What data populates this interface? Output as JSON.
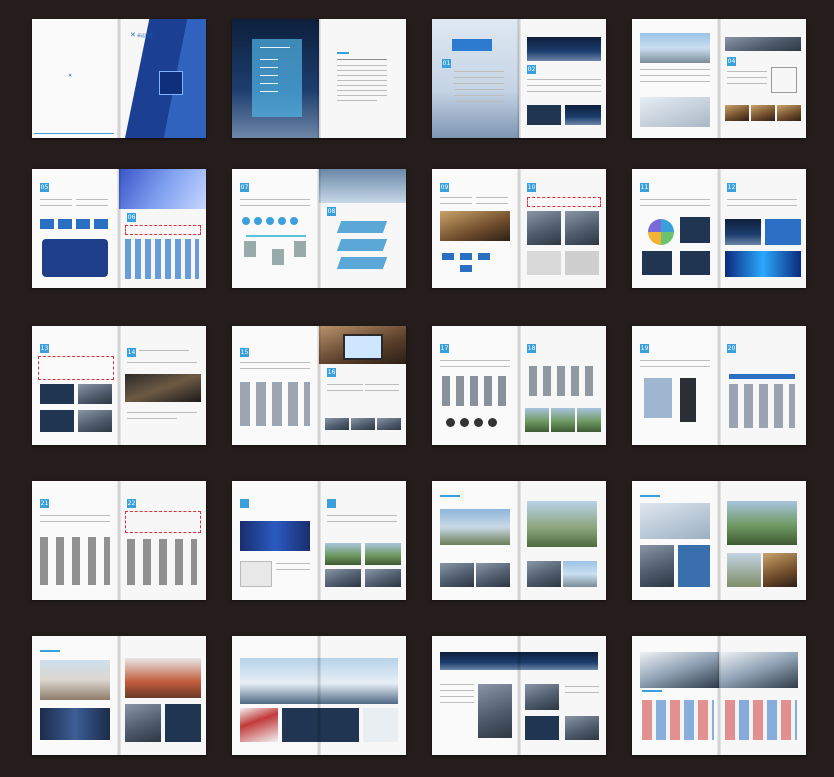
{
  "gallery": {
    "cover": {
      "logo_text": "卓远信息"
    },
    "page_numbers": [
      "01",
      "02",
      "03",
      "04",
      "05",
      "06",
      "07",
      "08",
      "09",
      "10",
      "11",
      "12",
      "13",
      "14",
      "15",
      "16",
      "17",
      "18",
      "19",
      "20",
      "21",
      "22"
    ],
    "colors": {
      "background": "#251d1b",
      "accent": "#3aa0dc",
      "highlight_dash": "#d9343b"
    }
  }
}
